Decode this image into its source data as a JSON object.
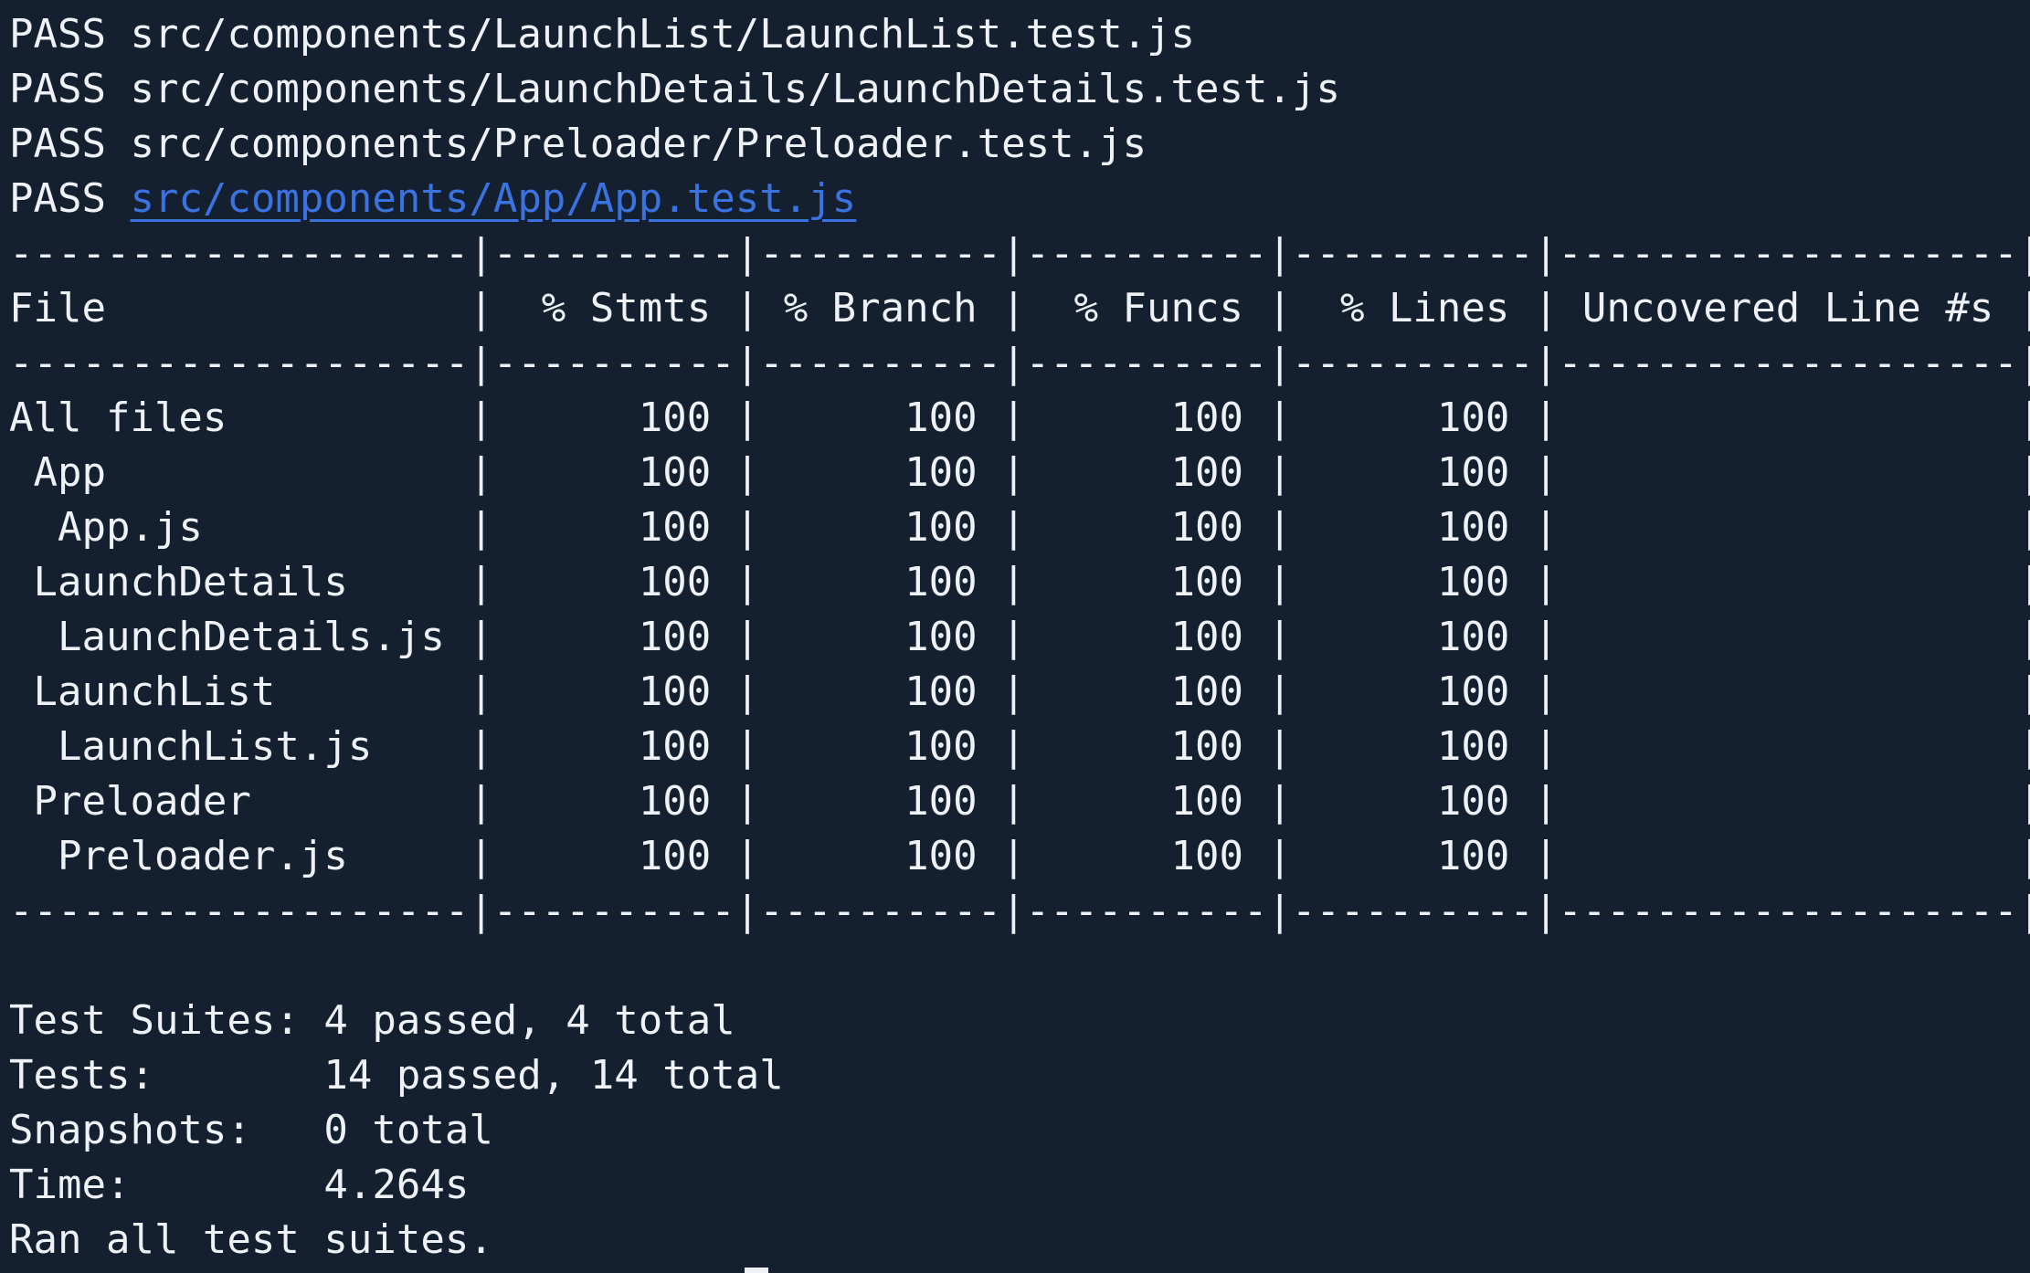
{
  "test_results": [
    {
      "status": "PASS",
      "path": "src/components/LaunchList/LaunchList.test.js"
    },
    {
      "status": "PASS",
      "path": "src/components/LaunchDetails/LaunchDetails.test.js"
    },
    {
      "status": "PASS",
      "path": "src/components/Preloader/Preloader.test.js"
    },
    {
      "status": "PASS",
      "path": "src/components/App/App.test.js"
    }
  ],
  "coverage": {
    "separator": "-------------------|----------|----------|----------|----------|-------------------|",
    "header": "File               |  % Stmts | % Branch |  % Funcs |  % Lines | Uncovered Line #s |",
    "rows": [
      "All files          |      100 |      100 |      100 |      100 |                   |",
      " App               |      100 |      100 |      100 |      100 |                   |",
      "  App.js           |      100 |      100 |      100 |      100 |                   |",
      " LaunchDetails     |      100 |      100 |      100 |      100 |                   |",
      "  LaunchDetails.js |      100 |      100 |      100 |      100 |                   |",
      " LaunchList        |      100 |      100 |      100 |      100 |                   |",
      "  LaunchList.js    |      100 |      100 |      100 |      100 |                   |",
      " Preloader         |      100 |      100 |      100 |      100 |                   |",
      "  Preloader.js     |      100 |      100 |      100 |      100 |                   |"
    ]
  },
  "summary": [
    "Test Suites: 4 passed, 4 total",
    "Tests:       14 passed, 14 total",
    "Snapshots:   0 total",
    "Time:        4.264s",
    "Ran all test suites."
  ],
  "colors": {
    "background": "#14202f",
    "text": "#eef1f5",
    "link": "#3a72e0"
  }
}
